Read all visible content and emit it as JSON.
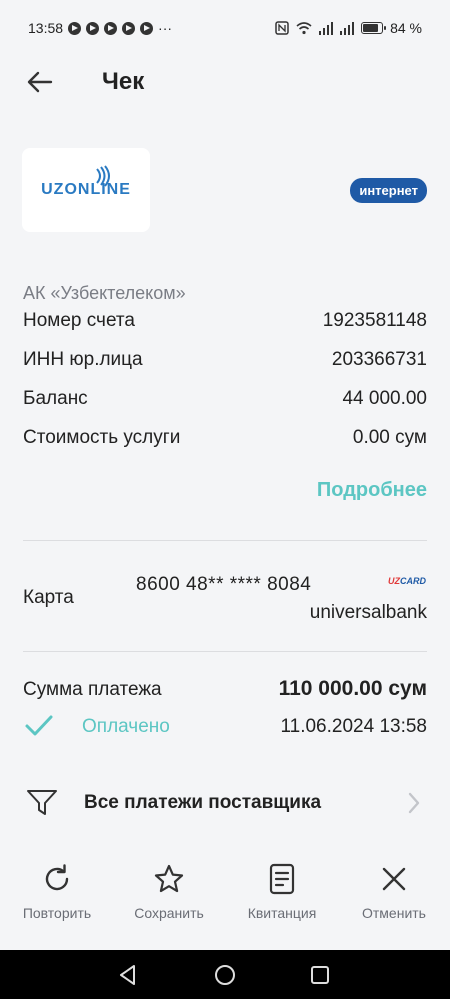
{
  "status": {
    "time": "13:58",
    "notif_icons": [
      "telegram-icon",
      "telegram-icon",
      "telegram-icon",
      "telegram-icon",
      "telegram-icon"
    ],
    "more": "···",
    "battery": "84 %"
  },
  "header": {
    "title": "Чек"
  },
  "merchant": {
    "logo_text": "UZONLINE",
    "badge": "интернет",
    "provider": "АК «Узбектелеком»",
    "rows": [
      {
        "label": "Номер счета",
        "value": "1923581148"
      },
      {
        "label": "ИНН юр.лица",
        "value": "203366731"
      },
      {
        "label": "Баланс",
        "value": "44 000.00"
      },
      {
        "label": "Стоимость услуги",
        "value": "0.00 сум"
      }
    ],
    "more_link": "Подробнее"
  },
  "card": {
    "label": "Карта",
    "number": "8600 48** **** 8084",
    "brand_prefix": "UZ",
    "brand_suffix": "CARD",
    "bank": "universalbank"
  },
  "payment": {
    "sum_label": "Сумма платежа",
    "sum_value": "110 000.00 сум",
    "status": "Оплачено",
    "datetime": "11.06.2024 13:58",
    "status_color": "#5cc6c3"
  },
  "all_payments": {
    "label": "Все платежи поставщика"
  },
  "actions": [
    {
      "label": "Повторить",
      "icon": "refresh-icon"
    },
    {
      "label": "Сохранить",
      "icon": "star-icon"
    },
    {
      "label": "Квитанция",
      "icon": "receipt-icon"
    },
    {
      "label": "Отменить",
      "icon": "close-icon"
    }
  ],
  "colors": {
    "accent": "#5cc6c3",
    "brand": "#1f5aa6",
    "background": "#f4f5f7"
  }
}
